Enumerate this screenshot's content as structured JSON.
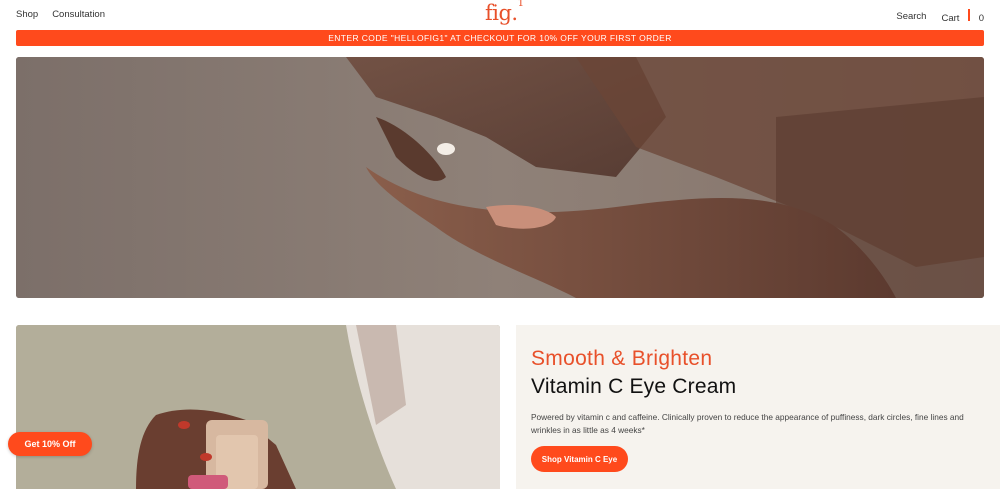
{
  "header": {
    "nav_left": [
      {
        "label": "Shop"
      },
      {
        "label": "Consultation"
      }
    ],
    "logo_text": "fig.",
    "logo_superscript": "1",
    "search_label": "Search",
    "cart_label": "Cart",
    "cart_count": "0"
  },
  "promo": {
    "text": "ENTER CODE \"HELLOFIG1\" AT CHECKOUT FOR 10% OFF YOUR FIRST ORDER"
  },
  "product": {
    "kicker": "Smooth & Brighten",
    "title": "Vitamin C Eye Cream",
    "description": "Powered by vitamin c and caffeine. Clinically proven to reduce the appearance of puffiness, dark circles, fine lines and wrinkles in as little as 4 weeks*",
    "button_label": "Shop Vitamin C Eye"
  },
  "offer_button_label": "Get 10% Off",
  "colors": {
    "accent": "#ff4a1c",
    "logo": "#e8502a",
    "panel_bg": "#f6f3ee"
  }
}
